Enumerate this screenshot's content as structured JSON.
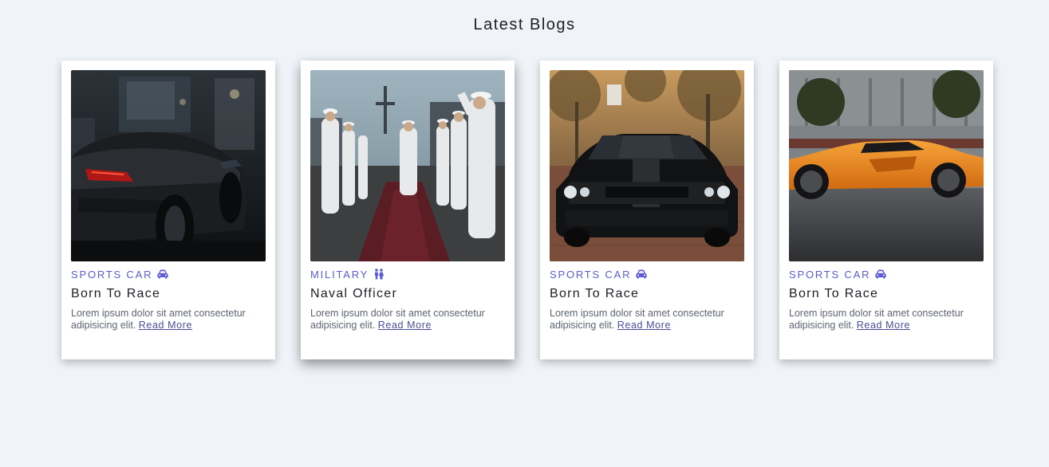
{
  "section_title": "Latest Blogs",
  "cards": [
    {
      "category": "SPORTS CAR",
      "category_icon": "car-icon",
      "title": "Born To Race",
      "excerpt": "Lorem ipsum dolor sit amet consectetur adipisicing elit.",
      "link": "Read More",
      "image": "black-sports-car-rear-photo"
    },
    {
      "category": "MILITARY",
      "category_icon": "people-icon",
      "title": "Naval Officer",
      "excerpt": "Lorem ipsum dolor sit amet consectetur adipisicing elit.",
      "link": "Read More",
      "image": "naval-officers-saluting-photo"
    },
    {
      "category": "SPORTS CAR",
      "category_icon": "car-icon",
      "title": "Born To Race",
      "excerpt": "Lorem ipsum dolor sit amet consectetur adipisicing elit.",
      "link": "Read More",
      "image": "black-muscle-car-front-photo"
    },
    {
      "category": "SPORTS CAR",
      "category_icon": "car-icon",
      "title": "Born To Race",
      "excerpt": "Lorem ipsum dolor sit amet consectetur adipisicing elit.",
      "link": "Read More",
      "image": "orange-supercar-side-photo"
    }
  ],
  "colors": {
    "background": "#f0f4f9",
    "card": "#ffffff",
    "category": "#5b5bd6",
    "heading": "#1c1f26",
    "body_text": "#5d6573",
    "link": "#4b4b9e"
  }
}
